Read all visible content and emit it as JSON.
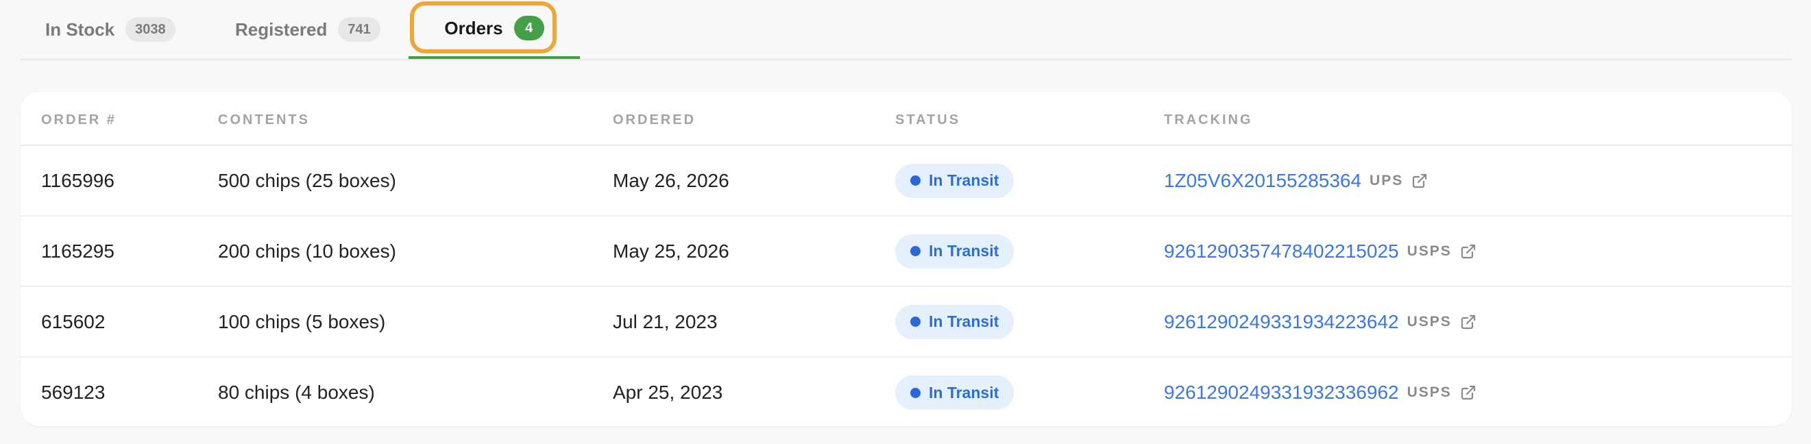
{
  "tabs": [
    {
      "label": "In Stock",
      "count": "3038",
      "active": false
    },
    {
      "label": "Registered",
      "count": "741",
      "active": false
    },
    {
      "label": "Orders",
      "count": "4",
      "active": true
    }
  ],
  "table": {
    "columns": [
      "ORDER #",
      "CONTENTS",
      "ORDERED",
      "STATUS",
      "TRACKING"
    ],
    "rows": [
      {
        "order": "1165996",
        "contents": "500 chips (25 boxes)",
        "ordered": "May 26, 2026",
        "status": "In Transit",
        "tracking": "1Z05V6X20155285364",
        "carrier": "UPS"
      },
      {
        "order": "1165295",
        "contents": "200 chips (10 boxes)",
        "ordered": "May 25, 2026",
        "status": "In Transit",
        "tracking": "9261290357478402215025",
        "carrier": "USPS"
      },
      {
        "order": "615602",
        "contents": "100 chips (5 boxes)",
        "ordered": "Jul 21, 2023",
        "status": "In Transit",
        "tracking": "9261290249331934223642",
        "carrier": "USPS"
      },
      {
        "order": "569123",
        "contents": "80 chips (4 boxes)",
        "ordered": "Apr 25, 2023",
        "status": "In Transit",
        "tracking": "9261290249331932336962",
        "carrier": "USPS"
      }
    ]
  },
  "colors": {
    "active_tab_accent": "#43a047",
    "focus_ring": "#f1a534",
    "status_text": "#2c6ed5",
    "status_bg": "#e5f0fd",
    "link": "#3a78e0"
  },
  "icons": {
    "external_link": "external-link-icon",
    "status_dot": "status-dot-icon"
  }
}
